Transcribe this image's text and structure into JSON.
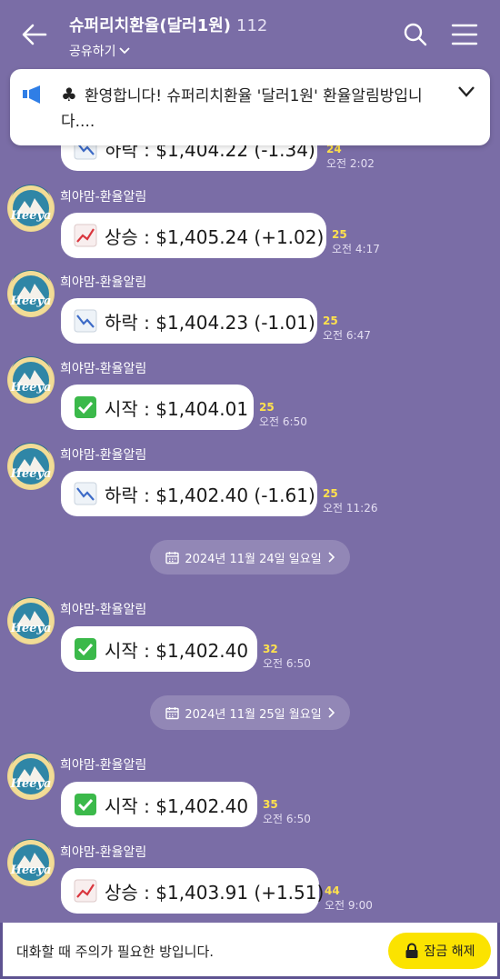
{
  "header": {
    "title": "슈퍼리치환율(달러1원)",
    "member_count": "112",
    "share_label": "공유하기"
  },
  "notice": {
    "text": "환영합니다! 슈퍼리치환율 '달러1원' 환율알림방입니다...."
  },
  "messages": [
    {
      "sender": "",
      "text": "하락 : $1,404.22 (-1.34)",
      "icon": "chart-down-icon",
      "unread": "24",
      "time": "오전 2:02"
    },
    {
      "sender": "희야맘-환율알림",
      "text": "상승 : $1,405.24 (+1.02)",
      "icon": "chart-up-icon",
      "unread": "25",
      "time": "오전 4:17"
    },
    {
      "sender": "희야맘-환율알림",
      "text": "하락 : $1,404.23 (-1.01)",
      "icon": "chart-down-icon",
      "unread": "25",
      "time": "오전 6:47"
    },
    {
      "sender": "희야맘-환율알림",
      "text": "시작 : $1,404.01",
      "icon": "check-icon",
      "unread": "25",
      "time": "오전 6:50"
    },
    {
      "sender": "희야맘-환율알림",
      "text": "하락 : $1,402.40 (-1.61)",
      "icon": "chart-down-icon",
      "unread": "25",
      "time": "오전 11:26"
    },
    {
      "sender": "희야맘-환율알림",
      "text": "시작 : $1,402.40",
      "icon": "check-icon",
      "unread": "32",
      "time": "오전 6:50"
    },
    {
      "sender": "희야맘-환율알림",
      "text": "시작 : $1,402.40",
      "icon": "check-icon",
      "unread": "35",
      "time": "오전 6:50"
    },
    {
      "sender": "희야맘-환율알림",
      "text": "상승 : $1,403.91 (+1.51)",
      "icon": "chart-up-icon",
      "unread": "44",
      "time": "오전 9:00"
    }
  ],
  "dates": [
    "2024년 11월 24일 일요일",
    "2024년 11월 25일 월요일"
  ],
  "footer": {
    "note": "대화할 때 주의가 필요한 방입니다.",
    "unlock_label": "잠금 해제"
  },
  "colors": {
    "background": "#7a6da6",
    "unread": "#ffe14d",
    "unlock": "#fbe300"
  }
}
